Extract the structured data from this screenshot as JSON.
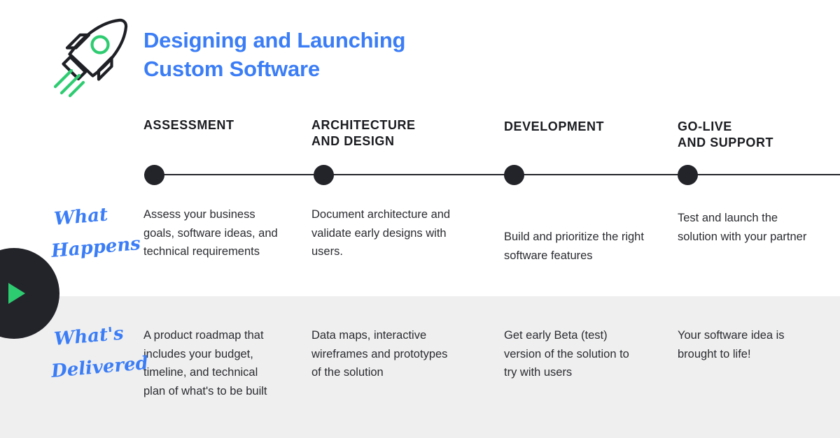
{
  "header": {
    "title_line1": "Designing and Launching",
    "title_line2": "Custom Software",
    "title_color": "#3b7df6",
    "rocket_icon": "rocket-icon"
  },
  "play_badge": {
    "icon": "play-triangle-icon",
    "color": "#2ecc71",
    "background": "#23242a"
  },
  "timeline": {
    "line_color": "#23242a",
    "dot_color": "#23242a",
    "stage_count": 4
  },
  "row_labels": [
    {
      "name": "what-happens",
      "line1": "What",
      "line2": "Happens"
    },
    {
      "name": "whats-delivered",
      "line1": "What's",
      "line2": "Delivered"
    }
  ],
  "columns": [
    {
      "key": "assessment",
      "heading_line1": "ASSESSMENT",
      "heading_line2": "",
      "what_happens": "Assess your business goals, software ideas, and technical requirements",
      "whats_delivered": "A product roadmap that includes your budget, timeline, and technical plan of what's to be built"
    },
    {
      "key": "architecture-and-design",
      "heading_line1": "ARCHITECTURE",
      "heading_line2": "AND DESIGN",
      "what_happens": "Document architecture and validate early designs with users.",
      "whats_delivered": "Data maps, interactive wireframes and prototypes of the solution"
    },
    {
      "key": "development",
      "heading_line1": "DEVELOPMENT",
      "heading_line2": "",
      "what_happens": "Build and prioritize the right software features",
      "whats_delivered": "Get early Beta (test) version of the solution to try with users"
    },
    {
      "key": "go-live-and-support",
      "heading_line1": "GO-LIVE",
      "heading_line2": "AND SUPPORT",
      "what_happens": "Test and launch the solution with your partner",
      "whats_delivered": "Your software idea is brought to life!"
    }
  ],
  "palette": {
    "accent_blue": "#3b7df6",
    "accent_green": "#2ecc71",
    "ink": "#23242a",
    "band_gray": "#efefef"
  }
}
